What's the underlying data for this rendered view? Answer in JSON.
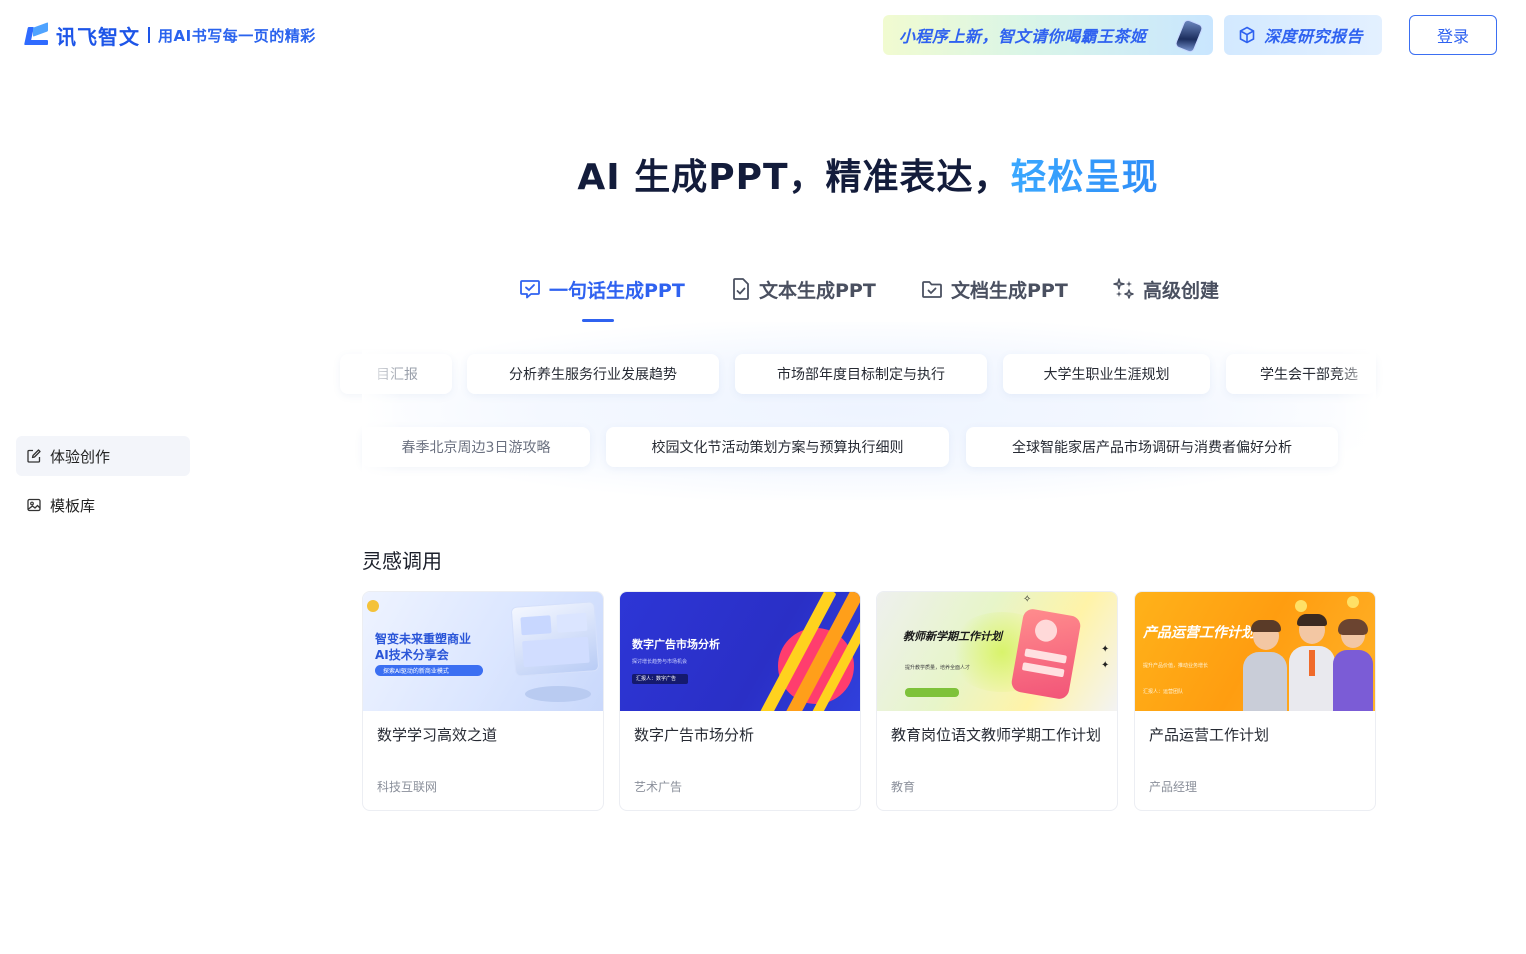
{
  "header": {
    "logo_name": "讯飞智文",
    "logo_slogan": "用AI书写每一页的精彩",
    "promo_mini": "小程序上新，智文请你喝霸王茶姬",
    "promo_research": "深度研究报告",
    "login_label": "登录"
  },
  "sidebar": {
    "items": [
      {
        "label": "体验创作",
        "icon": "edit-icon",
        "active": true
      },
      {
        "label": "模板库",
        "icon": "template-icon",
        "active": false
      }
    ]
  },
  "hero": {
    "title_main": "AI 生成PPT，精准表达，",
    "title_accent": "轻松呈现"
  },
  "tabs": [
    {
      "label": "一句话生成PPT",
      "icon": "chat-check-icon",
      "active": true
    },
    {
      "label": "文本生成PPT",
      "icon": "file-check-icon",
      "active": false
    },
    {
      "label": "文档生成PPT",
      "icon": "folder-check-icon",
      "active": false
    },
    {
      "label": "高级创建",
      "icon": "sparkle-icon",
      "active": false
    }
  ],
  "suggestions": {
    "row1": [
      "目汇报",
      "分析养生服务行业发展趋势",
      "市场部年度目标制定与执行",
      "大学生职业生涯规划",
      "学生会干部竞选"
    ],
    "row2": [
      "春季北京周边3日游攻略",
      "校园文化节活动策划方案与预算执行细则",
      "全球智能家居产品市场调研与消费者偏好分析"
    ]
  },
  "inspiration": {
    "title": "灵感调用",
    "cards": [
      {
        "name": "数学学习高效之道",
        "category": "科技互联网",
        "thumb_title_1": "智变未来重塑商业",
        "thumb_title_2": "AI技术分享会",
        "thumb_sub": "探索AI驱动的新商业模式"
      },
      {
        "name": "数字广告市场分析",
        "category": "艺术广告",
        "thumb_title_1": "数字广告市场分析",
        "thumb_sub": "探讨增长趋势与市场机会",
        "thumb_tag": "汇报人：数字广告"
      },
      {
        "name": "教育岗位语文教师学期工作计划",
        "category": "教育",
        "thumb_title_1": "教师新学期工作计划",
        "thumb_sub": "提升教学质量，培养全面人才",
        "thumb_tag": "汇报人：张老师"
      },
      {
        "name": "产品运营工作计划",
        "category": "产品经理",
        "thumb_title_1": "产品运营工作计划",
        "thumb_sub": "提升产品价值，推动业务增长",
        "thumb_tag": "汇报人：运营团队"
      }
    ]
  },
  "colors": {
    "accent": "#2f62f0",
    "accent_light": "#3aa8ff",
    "text": "#1f2430"
  }
}
